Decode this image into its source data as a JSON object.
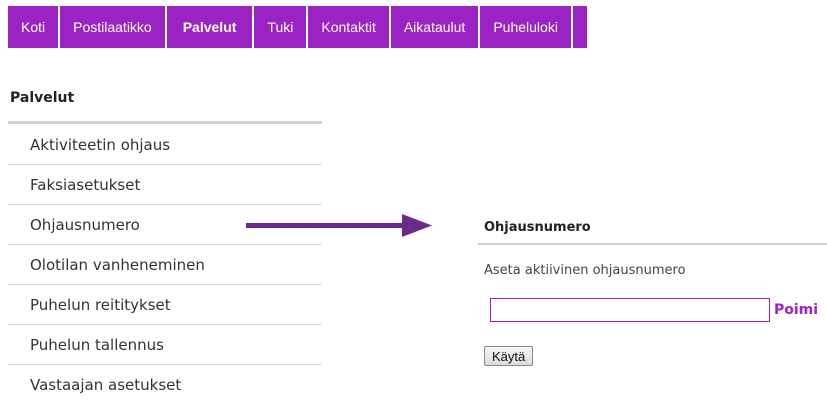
{
  "nav": {
    "tabs": [
      {
        "label": "Koti"
      },
      {
        "label": "Postilaatikko"
      },
      {
        "label": "Palvelut",
        "active": true
      },
      {
        "label": "Tuki"
      },
      {
        "label": "Kontaktit"
      },
      {
        "label": "Aikataulut"
      },
      {
        "label": "Puheluloki"
      }
    ]
  },
  "sidebar": {
    "title": "Palvelut",
    "items": [
      {
        "label": "Aktiviteetin ohjaus"
      },
      {
        "label": "Faksiasetukset"
      },
      {
        "label": "Ohjausnumero"
      },
      {
        "label": "Olotilan vanheneminen"
      },
      {
        "label": "Puhelun reititykset"
      },
      {
        "label": "Puhelun tallennus"
      },
      {
        "label": "Vastaajan asetukset"
      }
    ]
  },
  "panel": {
    "title": "Ohjausnumero",
    "description": "Aseta aktiivinen ohjausnumero",
    "field_value": "",
    "pick_label": "Poimi",
    "apply_label": "Käytä"
  },
  "colors": {
    "accent": "#9b23c4",
    "arrow": "#6a2a8a"
  },
  "icons": {
    "arrow": "arrow-right-icon"
  }
}
